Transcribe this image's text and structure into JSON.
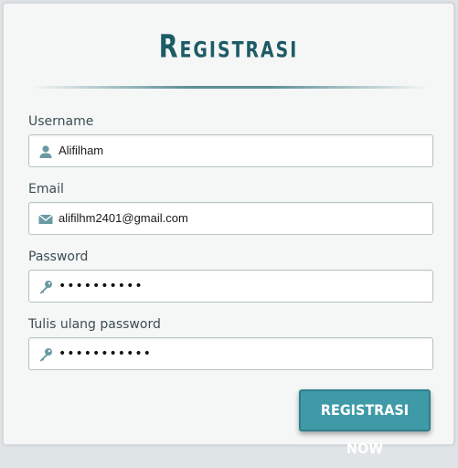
{
  "form": {
    "title": "Registrasi",
    "fields": [
      {
        "label": "Username",
        "value": "Alifilham",
        "icon": "user-icon",
        "type": "text"
      },
      {
        "label": "Email",
        "value": "alifilhm2401@gmail.com",
        "icon": "mail-icon",
        "type": "email"
      },
      {
        "label": "Password",
        "value": "••••••••••",
        "icon": "key-icon",
        "type": "password"
      },
      {
        "label": "Tulis ulang password",
        "value": "•••••••••••",
        "icon": "key-icon",
        "type": "password"
      }
    ],
    "submit_label": "REGISTRASI NOW"
  },
  "colors": {
    "title": "#1c5c66",
    "accent": "#3f9aa8",
    "icon": "#6a9aa3"
  }
}
